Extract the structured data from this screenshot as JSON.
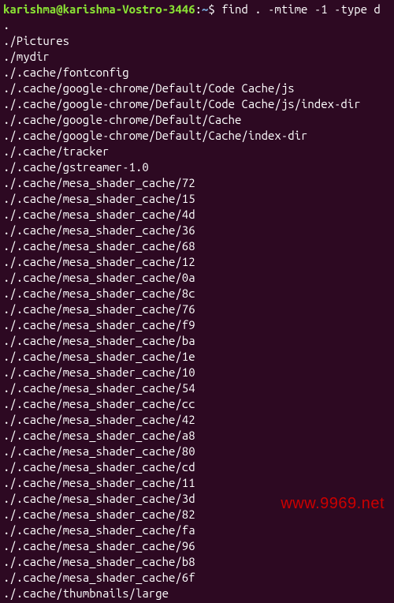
{
  "prompt": {
    "user_host": "karishma@karishma-Vostro-3446",
    "colon": ":",
    "path": "~",
    "dollar": "$ "
  },
  "command": "find . -mtime -1 -type d",
  "output": [
    ".",
    "./Pictures",
    "./mydir",
    "./.cache/fontconfig",
    "./.cache/google-chrome/Default/Code Cache/js",
    "./.cache/google-chrome/Default/Code Cache/js/index-dir",
    "./.cache/google-chrome/Default/Cache",
    "./.cache/google-chrome/Default/Cache/index-dir",
    "./.cache/tracker",
    "./.cache/gstreamer-1.0",
    "./.cache/mesa_shader_cache/72",
    "./.cache/mesa_shader_cache/15",
    "./.cache/mesa_shader_cache/4d",
    "./.cache/mesa_shader_cache/36",
    "./.cache/mesa_shader_cache/68",
    "./.cache/mesa_shader_cache/12",
    "./.cache/mesa_shader_cache/0a",
    "./.cache/mesa_shader_cache/8c",
    "./.cache/mesa_shader_cache/76",
    "./.cache/mesa_shader_cache/f9",
    "./.cache/mesa_shader_cache/ba",
    "./.cache/mesa_shader_cache/1e",
    "./.cache/mesa_shader_cache/10",
    "./.cache/mesa_shader_cache/54",
    "./.cache/mesa_shader_cache/cc",
    "./.cache/mesa_shader_cache/42",
    "./.cache/mesa_shader_cache/a8",
    "./.cache/mesa_shader_cache/80",
    "./.cache/mesa_shader_cache/cd",
    "./.cache/mesa_shader_cache/11",
    "./.cache/mesa_shader_cache/3d",
    "./.cache/mesa_shader_cache/82",
    "./.cache/mesa_shader_cache/fa",
    "./.cache/mesa_shader_cache/96",
    "./.cache/mesa_shader_cache/b8",
    "./.cache/mesa_shader_cache/6f",
    "./.cache/thumbnails/large"
  ],
  "watermark": "www.9969.net"
}
